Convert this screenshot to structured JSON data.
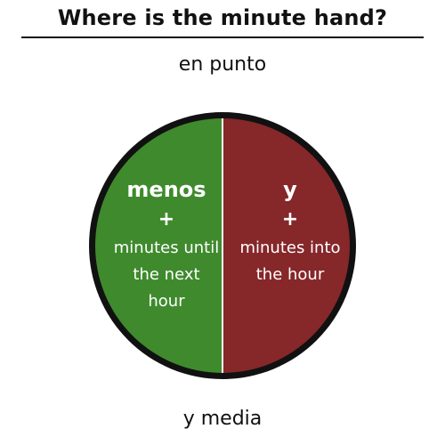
{
  "title": "Where is the minute hand?",
  "top_label": "en punto",
  "bottom_label": "y media",
  "left_half": {
    "word": "menos",
    "plus": "+",
    "description": "minutes until the next hour",
    "color": "#3f8a2d"
  },
  "right_half": {
    "word": "y",
    "plus": "+",
    "description": "minutes into the hour",
    "color": "#86272a"
  },
  "ring_color": "#111111",
  "divider_color": "#ffffff"
}
